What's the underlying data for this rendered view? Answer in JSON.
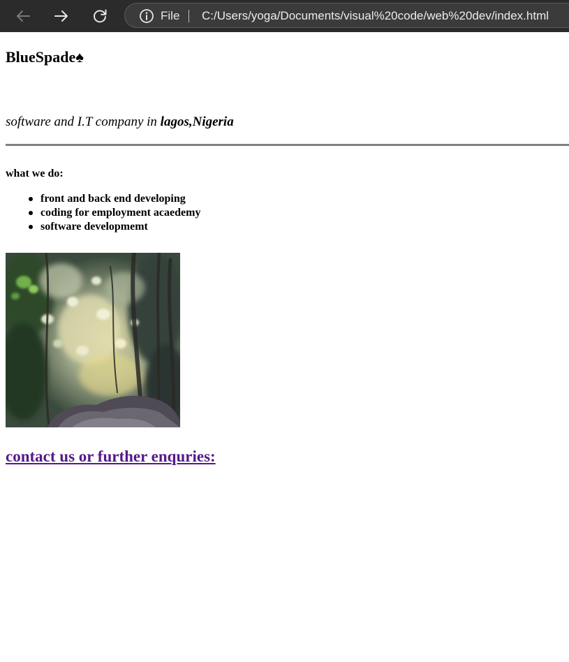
{
  "browser": {
    "site_info_label": "File",
    "url": "C:/Users/yoga/Documents/visual%20code/web%20dev/index.html"
  },
  "page": {
    "brand": "BlueSpade♠",
    "tagline_prefix": "software and I.T company in ",
    "tagline_location": "lagos,Nigeria",
    "services_heading": "what we do:",
    "services": [
      "front and back end developing",
      "coding for employment acaedemy",
      "software developmemt"
    ],
    "contact_link": "contact us or further enquries:"
  },
  "colors": {
    "chrome_bg": "#2b2b2b",
    "visited_link": "#551a8b",
    "rule": "#808080"
  },
  "icons": {
    "back": "arrow-left-icon",
    "forward": "arrow-right-icon",
    "reload": "reload-icon",
    "site_info": "info-circle-icon"
  }
}
